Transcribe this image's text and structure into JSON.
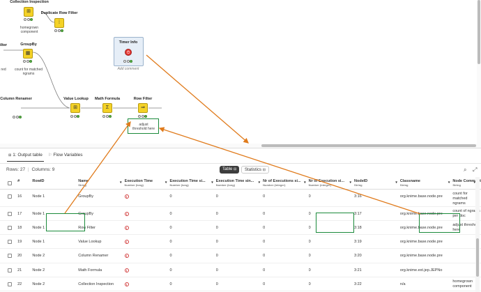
{
  "canvas": {
    "nodes": {
      "collection_inspection": {
        "title": "Collection Inspection",
        "comment": "homegrown component"
      },
      "duplicate_row_filter": {
        "title": "Duplicate Row Filter"
      },
      "filter_partial": {
        "title": "ilter",
        "comment": "red"
      },
      "groupby": {
        "title": "GroupBy",
        "comment": "count for matched ngrams"
      },
      "timer_info": {
        "title": "Timer Info",
        "comment": "Add comment"
      },
      "column_renamer": {
        "title": "Column Renamer"
      },
      "value_lookup": {
        "title": "Value Lookup"
      },
      "math_formula": {
        "title": "Math Formula"
      },
      "row_filter": {
        "title": "Row Filter",
        "comment": "adjust threshold here"
      }
    }
  },
  "panel": {
    "tabs": [
      {
        "label": "1: Output table"
      },
      {
        "label": "Flow Variables"
      }
    ],
    "rows_label": "Rows: 27",
    "columns_label": "Columns: 9",
    "view_toggle": {
      "table": "Table",
      "statistics": "Statistics"
    },
    "headers": [
      {
        "name": "#",
        "type": ""
      },
      {
        "name": "RowID",
        "type": ""
      },
      {
        "name": "Name",
        "type": "String"
      },
      {
        "name": "Execution Time",
        "type": "Number (long)"
      },
      {
        "name": "Execution Time si...",
        "type": "Number (long)"
      },
      {
        "name": "Execution Time sin...",
        "type": "Number (long)"
      },
      {
        "name": "Nr of Executions si...",
        "type": "Number (integer)"
      },
      {
        "name": "Nr of Execution si...",
        "type": "Number (integer)"
      },
      {
        "name": "NodeID",
        "type": "String"
      },
      {
        "name": "Classname",
        "type": "String"
      },
      {
        "name": "Node Comment",
        "type": "String"
      }
    ],
    "rows": [
      {
        "n": "16",
        "rowid": "Node 1",
        "name": "GroupBy",
        "t2": "0",
        "t3": "0",
        "e1": "0",
        "e2": "0",
        "nodeid": "3:16",
        "classname": "org.knime.base.node.pre",
        "comment": "count for matched ngrams"
      },
      {
        "n": "17",
        "rowid": "Node 1",
        "name": "GroupBy",
        "t2": "0",
        "t3": "0",
        "e1": "0",
        "e2": "0",
        "nodeid": "3:17",
        "classname": "org.knime.base.node.pre",
        "comment": "count of ngrams per doc"
      },
      {
        "n": "18",
        "rowid": "Node 1",
        "name": "Row Filter",
        "t2": "0",
        "t3": "0",
        "e1": "0",
        "e2": "0",
        "nodeid": "3:18",
        "classname": "org.knime.base.node.pre",
        "comment": "adjust threshold here"
      },
      {
        "n": "19",
        "rowid": "Node 1",
        "name": "Value Lookup",
        "t2": "0",
        "t3": "0",
        "e1": "0",
        "e2": "0",
        "nodeid": "3:19",
        "classname": "org.knime.base.node.pre",
        "comment": ""
      },
      {
        "n": "20",
        "rowid": "Node 2",
        "name": "Column Renamer",
        "t2": "0",
        "t3": "0",
        "e1": "0",
        "e2": "0",
        "nodeid": "3:20",
        "classname": "org.knime.base.node.pre",
        "comment": ""
      },
      {
        "n": "21",
        "rowid": "Node 2",
        "name": "Math Formula",
        "t2": "0",
        "t3": "0",
        "e1": "0",
        "e2": "0",
        "nodeid": "3:21",
        "classname": "org.knime.ext.jep.JEPNo",
        "comment": ""
      },
      {
        "n": "22",
        "rowid": "Node 2",
        "name": "Collection Inspection",
        "t2": "0",
        "t3": "0",
        "e1": "0",
        "e2": "0",
        "nodeid": "3:22",
        "classname": "n/a",
        "comment": "homegrown component"
      }
    ]
  },
  "colors": {
    "annotation": "#1a8a3a",
    "arrow": "#e07b1c",
    "node": "#f4d227",
    "timer": "#e53935"
  }
}
